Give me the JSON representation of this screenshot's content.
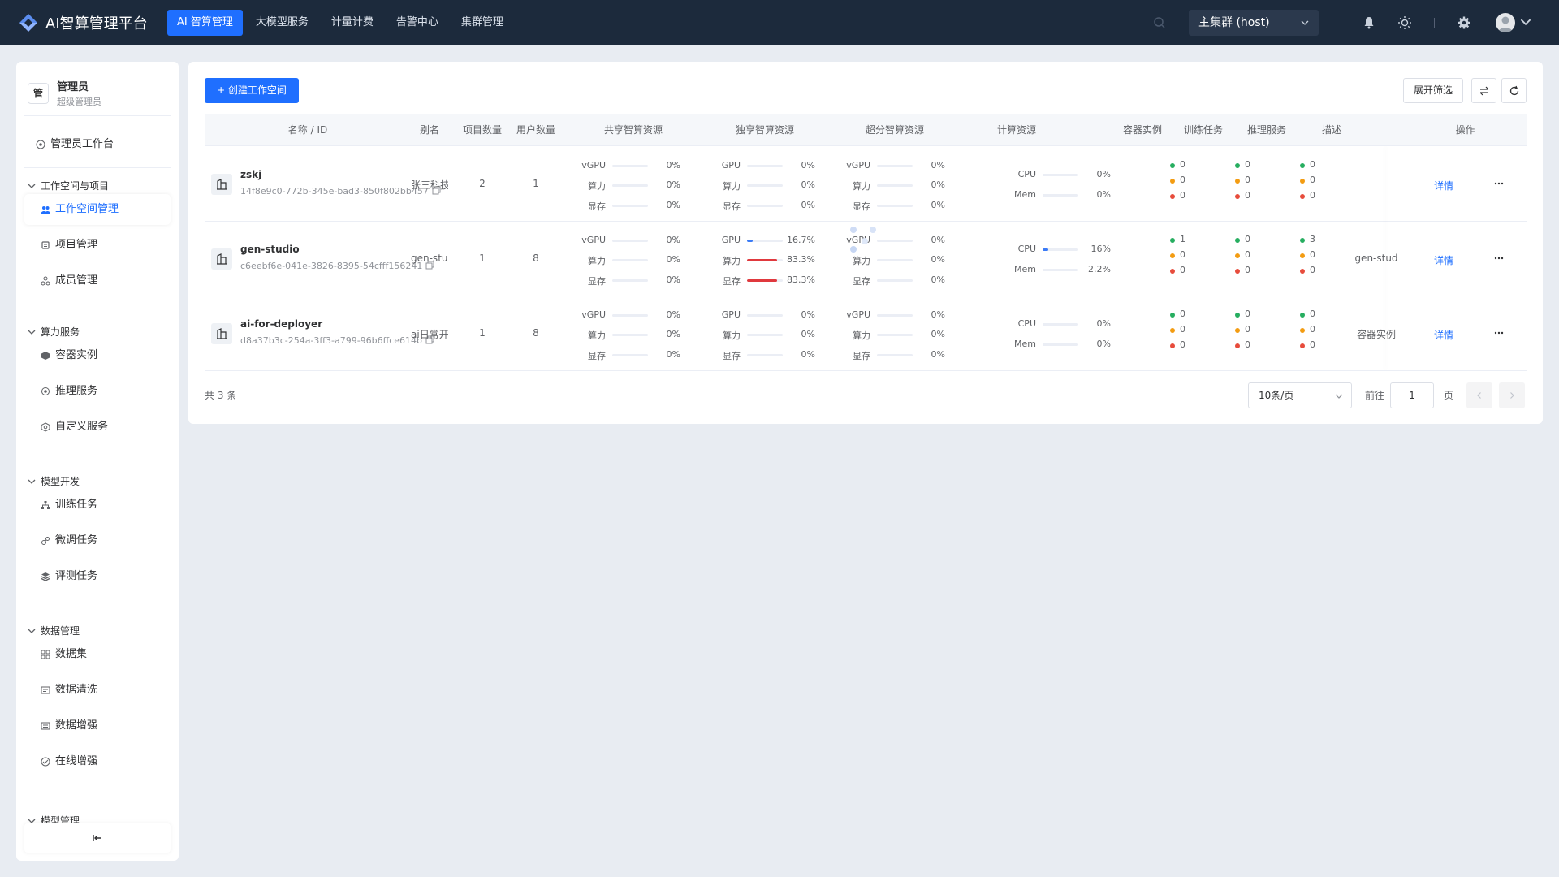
{
  "brand": {
    "title": "AI智算管理平台",
    "color": "#1f6fff"
  },
  "nav": {
    "items": [
      "AI 智算管理",
      "大模型服务",
      "计量计费",
      "告警中心",
      "集群管理"
    ],
    "active_index": 0
  },
  "topbar": {
    "cluster": "主集群 (host)"
  },
  "sidebar": {
    "user_badge": "管",
    "user_name": "管理员",
    "user_role": "超级管理员",
    "workbench": "管理员工作台",
    "groups": [
      {
        "title": "工作空间与项目",
        "items": [
          "工作空间管理",
          "项目管理",
          "成员管理"
        ]
      },
      {
        "title": "算力服务",
        "items": [
          "容器实例",
          "推理服务",
          "自定义服务"
        ]
      },
      {
        "title": "模型开发",
        "items": [
          "训练任务",
          "微调任务",
          "评测任务"
        ]
      },
      {
        "title": "数据管理",
        "items": [
          "数据集",
          "数据清洗",
          "数据增强",
          "在线增强"
        ]
      },
      {
        "title": "模型管理",
        "items": []
      }
    ],
    "active_item": "工作空间管理",
    "collapse_icon": "collapse-sidebar-icon"
  },
  "toolbar": {
    "create_label": "+  创建工作空间",
    "filter_label": "展开筛选"
  },
  "table": {
    "columns": [
      "名称 / ID",
      "别名",
      "项目数量",
      "用户数量",
      "共享智算资源",
      "独享智算资源",
      "超分智算资源",
      "计算资源",
      "容器实例",
      "训练任务",
      "推理服务",
      "描述",
      "操作"
    ],
    "action_label": "详情",
    "rows": [
      {
        "name": "zskj",
        "id": "14f8e9c0-772b-345e-bad3-850f802bb457",
        "alias": "张三科技...",
        "projects": "2",
        "users": "1",
        "shared": [
          {
            "label": "vGPU",
            "value": "0%",
            "pct": 0
          },
          {
            "label": "算力",
            "value": "0%",
            "pct": 0
          },
          {
            "label": "显存",
            "value": "0%",
            "pct": 0
          }
        ],
        "exclusive": [
          {
            "label": "GPU",
            "value": "0%",
            "pct": 0
          },
          {
            "label": "算力",
            "value": "0%",
            "pct": 0
          },
          {
            "label": "显存",
            "value": "0%",
            "pct": 0
          }
        ],
        "oversold": [
          {
            "label": "vGPU",
            "value": "0%",
            "pct": 0
          },
          {
            "label": "算力",
            "value": "0%",
            "pct": 0
          },
          {
            "label": "显存",
            "value": "0%",
            "pct": 0
          }
        ],
        "compute": [
          {
            "label": "CPU",
            "value": "0%",
            "pct": 0
          },
          {
            "label": "Mem",
            "value": "0%",
            "pct": 0
          }
        ],
        "containers": [
          "0",
          "0",
          "0"
        ],
        "training": [
          "0",
          "0",
          "0"
        ],
        "inference": [
          "0",
          "0",
          "0"
        ],
        "desc": "--"
      },
      {
        "name": "gen-studio",
        "id": "c6eebf6e-041e-3826-8395-54cfff156241",
        "alias": "gen-studio",
        "projects": "1",
        "users": "8",
        "shared": [
          {
            "label": "vGPU",
            "value": "0%",
            "pct": 0
          },
          {
            "label": "算力",
            "value": "0%",
            "pct": 0
          },
          {
            "label": "显存",
            "value": "0%",
            "pct": 0
          }
        ],
        "exclusive": [
          {
            "label": "GPU",
            "value": "16.7%",
            "pct": 16.7
          },
          {
            "label": "算力",
            "value": "83.3%",
            "pct": 83.3
          },
          {
            "label": "显存",
            "value": "83.3%",
            "pct": 83.3
          }
        ],
        "oversold": [
          {
            "label": "vGPU",
            "value": "0%",
            "pct": 0
          },
          {
            "label": "算力",
            "value": "0%",
            "pct": 0
          },
          {
            "label": "显存",
            "value": "0%",
            "pct": 0
          }
        ],
        "compute": [
          {
            "label": "CPU",
            "value": "16%",
            "pct": 16
          },
          {
            "label": "Mem",
            "value": "2.2%",
            "pct": 2.2
          }
        ],
        "containers": [
          "1",
          "0",
          "0"
        ],
        "training": [
          "0",
          "0",
          "0"
        ],
        "inference": [
          "3",
          "0",
          "0"
        ],
        "desc": "gen-stud"
      },
      {
        "name": "ai-for-deployer",
        "id": "d8a37b3c-254a-3ff3-a799-96b6ffce614b",
        "alias": "ai日常开发",
        "projects": "1",
        "users": "8",
        "shared": [
          {
            "label": "vGPU",
            "value": "0%",
            "pct": 0
          },
          {
            "label": "算力",
            "value": "0%",
            "pct": 0
          },
          {
            "label": "显存",
            "value": "0%",
            "pct": 0
          }
        ],
        "exclusive": [
          {
            "label": "GPU",
            "value": "0%",
            "pct": 0
          },
          {
            "label": "算力",
            "value": "0%",
            "pct": 0
          },
          {
            "label": "显存",
            "value": "0%",
            "pct": 0
          }
        ],
        "oversold": [
          {
            "label": "vGPU",
            "value": "0%",
            "pct": 0
          },
          {
            "label": "算力",
            "value": "0%",
            "pct": 0
          },
          {
            "label": "显存",
            "value": "0%",
            "pct": 0
          }
        ],
        "compute": [
          {
            "label": "CPU",
            "value": "0%",
            "pct": 0
          },
          {
            "label": "Mem",
            "value": "0%",
            "pct": 0
          }
        ],
        "containers": [
          "0",
          "0",
          "0"
        ],
        "training": [
          "0",
          "0",
          "0"
        ],
        "inference": [
          "0",
          "0",
          "0"
        ],
        "desc": "容器实例"
      }
    ]
  },
  "status_colors": [
    "#27ae60",
    "#f39c12",
    "#e74c3c"
  ],
  "bar_colors": {
    "low": "#3b7bf6",
    "high": "#e0393e"
  },
  "pagination": {
    "total": "共 3 条",
    "page_size": "10条/页",
    "goto": "前往",
    "page": "1",
    "unit": "页"
  }
}
